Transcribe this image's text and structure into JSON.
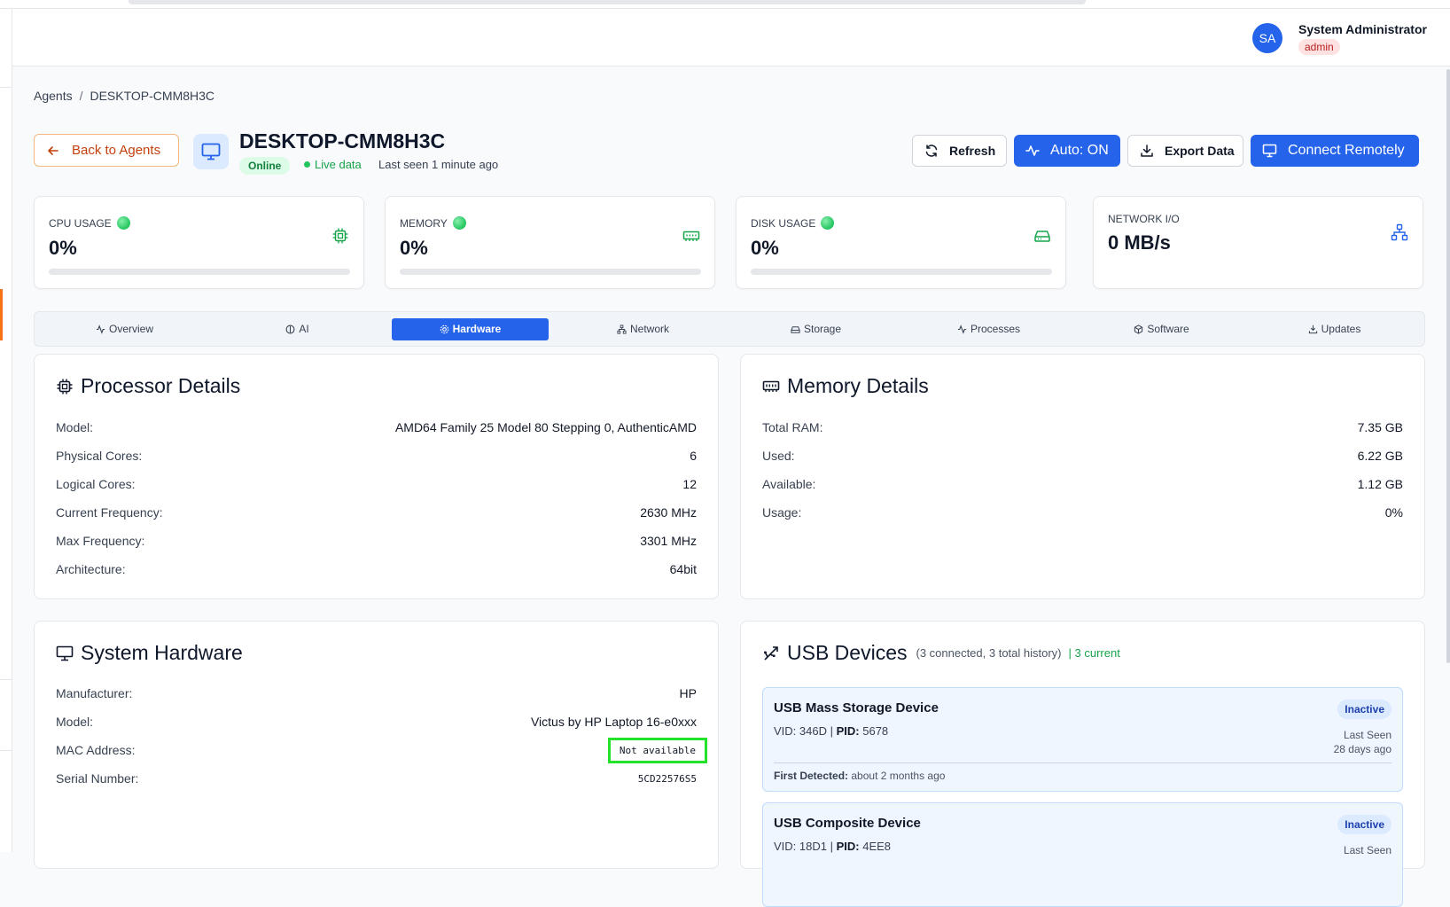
{
  "user": {
    "initials": "SA",
    "name": "System Administrator",
    "role": "admin"
  },
  "breadcrumb": {
    "parent": "Agents",
    "separator": "/",
    "current": "DESKTOP-CMM8H3C"
  },
  "agent": {
    "back_label": "Back to Agents",
    "name": "DESKTOP-CMM8H3C",
    "status": "Online",
    "live_label": "Live data",
    "last_seen": "Last seen 1 minute ago"
  },
  "actions": {
    "refresh": "Refresh",
    "auto": "Auto: ON",
    "export": "Export Data",
    "connect": "Connect Remotely"
  },
  "metrics": [
    {
      "label": "CPU USAGE",
      "value": "0%",
      "percent": 0,
      "icon": "cpu-icon"
    },
    {
      "label": "MEMORY",
      "value": "0%",
      "percent": 0,
      "icon": "memory-icon"
    },
    {
      "label": "DISK USAGE",
      "value": "0%",
      "percent": 0,
      "icon": "disk-icon"
    },
    {
      "label": "NETWORK I/O",
      "value": "0 MB/s",
      "icon": "network-icon"
    }
  ],
  "tabs": [
    {
      "label": "Overview",
      "icon": "activity-icon"
    },
    {
      "label": "AI",
      "icon": "ai-icon"
    },
    {
      "label": "Hardware",
      "icon": "gear-icon",
      "active": true
    },
    {
      "label": "Network",
      "icon": "network-icon"
    },
    {
      "label": "Storage",
      "icon": "hard-drive-icon"
    },
    {
      "label": "Processes",
      "icon": "activity-icon"
    },
    {
      "label": "Software",
      "icon": "package-icon"
    },
    {
      "label": "Updates",
      "icon": "download-icon"
    }
  ],
  "processor": {
    "title": "Processor Details",
    "rows": [
      {
        "key": "Model:",
        "value": "AMD64 Family 25 Model 80 Stepping 0, AuthenticAMD"
      },
      {
        "key": "Physical Cores:",
        "value": "6"
      },
      {
        "key": "Logical Cores:",
        "value": "12"
      },
      {
        "key": "Current Frequency:",
        "value": "2630 MHz"
      },
      {
        "key": "Max Frequency:",
        "value": "3301 MHz"
      },
      {
        "key": "Architecture:",
        "value": "64bit"
      }
    ]
  },
  "memory": {
    "title": "Memory Details",
    "rows": [
      {
        "key": "Total RAM:",
        "value": "7.35 GB"
      },
      {
        "key": "Used:",
        "value": "6.22 GB"
      },
      {
        "key": "Available:",
        "value": "1.12 GB"
      },
      {
        "key": "Usage:",
        "value": "0%"
      }
    ]
  },
  "system_hardware": {
    "title": "System Hardware",
    "rows": [
      {
        "key": "Manufacturer:",
        "value": "HP"
      },
      {
        "key": "Model:",
        "value": "Victus by HP Laptop 16-e0xxx"
      },
      {
        "key": "MAC Address:",
        "value": "Not available"
      },
      {
        "key": "Serial Number:",
        "value": "5CD22576S5"
      }
    ]
  },
  "usb": {
    "title": "USB Devices",
    "summary": "(3 connected, 3 total history)",
    "current": "| 3 current",
    "devices": [
      {
        "name": "USB Mass Storage Device",
        "vid_label": "VID:",
        "vid": "346D",
        "pid_label": "PID:",
        "pid": "5678",
        "status": "Inactive",
        "last_seen_label": "Last Seen",
        "last_seen": "28 days ago",
        "first_detected_label": "First Detected:",
        "first_detected": "about 2 months ago"
      },
      {
        "name": "USB Composite Device",
        "vid_label": "VID:",
        "vid": "18D1",
        "pid_label": "PID:",
        "pid": "4EE8",
        "status": "Inactive",
        "last_seen_label": "Last Seen"
      }
    ]
  },
  "colors": {
    "primary": "#2563eb",
    "success": "#22c55e",
    "warning": "#f97316",
    "highlight": "#22e32a"
  }
}
